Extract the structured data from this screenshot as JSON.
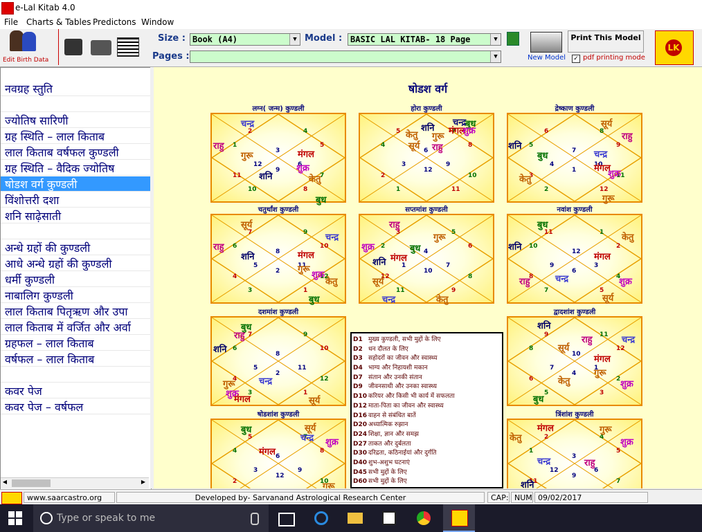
{
  "window": {
    "title": "e-Lal Kitab 4.0"
  },
  "menu": [
    "File",
    "Charts & Tables",
    "Predictons",
    "Window"
  ],
  "toolbar": {
    "edit_birth_data": "Edit Birth Data",
    "size_label": "Size :",
    "size_value": "Book (A4)",
    "model_label": "Model :",
    "model_value": "BASIC LAL KITAB- 18 Page",
    "pages_label": "Pages :",
    "pages_value": "",
    "print_model": "Print This Model",
    "new_model": "New Model",
    "pdf_mode": "pdf printing mode"
  },
  "sidebar": {
    "items": [
      {
        "label": "नवग्रह स्तुति",
        "selected": false
      },
      {
        "label": "",
        "selected": false
      },
      {
        "label": "ज्योतिष सारिणी",
        "selected": false
      },
      {
        "label": "ग्रह स्थिति – लाल किताब",
        "selected": false
      },
      {
        "label": "लाल किताब वर्षफल कुण्डली",
        "selected": false
      },
      {
        "label": "ग्रह स्थिति – वैदिक ज्योतिष",
        "selected": false
      },
      {
        "label": "षोडश वर्ग कुण्डली",
        "selected": true
      },
      {
        "label": "विंशोत्तरी दशा",
        "selected": false
      },
      {
        "label": "शनि साढ़ेसाती",
        "selected": false
      },
      {
        "label": "",
        "selected": false
      },
      {
        "label": "अन्धे ग्रहों की कुण्डली",
        "selected": false
      },
      {
        "label": "आधे अन्धे ग्रहों की कुण्डली",
        "selected": false
      },
      {
        "label": "धर्मी कुण्डली",
        "selected": false
      },
      {
        "label": "नाबालिग कुण्डली",
        "selected": false
      },
      {
        "label": "लाल किताब पितृऋण और उपा",
        "selected": false
      },
      {
        "label": "लाल किताब में वर्जित और अर्वा",
        "selected": false
      },
      {
        "label": "ग्रहफल – लाल किताब",
        "selected": false
      },
      {
        "label": "वर्षफल – लाल किताब",
        "selected": false
      },
      {
        "label": "",
        "selected": false
      },
      {
        "label": "कवर पेज",
        "selected": false
      },
      {
        "label": "कवर पेज – वर्षफल",
        "selected": false
      }
    ]
  },
  "main": {
    "heading": "षोडश वर्ग",
    "charts": [
      {
        "title": "लग्न( जन्म) कुण्डली",
        "houses": [
          "3",
          "2",
          "1",
          "12",
          "11",
          "10",
          "9",
          "8",
          "7",
          "6",
          "5",
          "4"
        ],
        "planets": [
          [
            "चन्द्र",
            "#3a3ad0",
            42,
            4
          ],
          [
            "राहु",
            "#c00080",
            2,
            36
          ],
          [
            "गुरू",
            "#c06000",
            42,
            50
          ],
          [
            "मंगल",
            "#c00000",
            124,
            48
          ],
          [
            "शुक्र",
            "#c000c0",
            122,
            68
          ],
          [
            "शनि",
            "#000066",
            68,
            80
          ],
          [
            "केतु",
            "#c06000",
            140,
            84
          ],
          [
            "बुध",
            "#007000",
            150,
            114
          ]
        ]
      },
      {
        "title": "होरा कुण्डली",
        "houses": [
          "6",
          "5",
          "4",
          "3",
          "2",
          "1",
          "12",
          "11",
          "10",
          "9",
          "8",
          "7"
        ],
        "planets": [
          [
            "शनि",
            "#000066",
            88,
            10
          ],
          [
            "चन्द्र",
            "#0a0a7a",
            134,
            2
          ],
          [
            "बुध",
            "#007000",
            152,
            4
          ],
          [
            "केतु",
            "#c06000",
            66,
            20
          ],
          [
            "गुरू",
            "#c06000",
            104,
            22
          ],
          [
            "सूर्य",
            "#c06000",
            70,
            36
          ],
          [
            "राहु",
            "#c00080",
            104,
            38
          ],
          [
            "मंगल",
            "#c00000",
            128,
            14
          ],
          [
            "शुक्र",
            "#c000c0",
            148,
            14
          ]
        ]
      },
      {
        "title": "द्रेष्काण कुण्डली",
        "houses": [
          "7",
          "6",
          "5",
          "4",
          "3",
          "2",
          "1",
          "12",
          "11",
          "10",
          "9",
          "8"
        ],
        "planets": [
          [
            "सूर्य",
            "#c06000",
            134,
            4
          ],
          [
            "राहु",
            "#c00080",
            164,
            22
          ],
          [
            "शनि",
            "#000066",
            0,
            36
          ],
          [
            "बुध",
            "#007000",
            42,
            50
          ],
          [
            "चन्द्र",
            "#3a3ad0",
            124,
            48
          ],
          [
            "मंगल",
            "#c00000",
            124,
            68
          ],
          [
            "शुक्र",
            "#c000c0",
            144,
            76
          ],
          [
            "केतु",
            "#c06000",
            16,
            84
          ],
          [
            "गुरू",
            "#c06000",
            136,
            112
          ]
        ]
      },
      {
        "title": "चतुर्थांश कुण्डली",
        "houses": [
          "8",
          "7",
          "6",
          "5",
          "4",
          "3",
          "2",
          "1",
          "12",
          "11",
          "10",
          "9"
        ],
        "planets": [
          [
            "सूर्य",
            "#c06000",
            42,
            4
          ],
          [
            "चन्द्र",
            "#3a3ad0",
            164,
            22
          ],
          [
            "राहु",
            "#c00080",
            2,
            36
          ],
          [
            "शनि",
            "#000066",
            42,
            50
          ],
          [
            "मंगल",
            "#c00000",
            124,
            48
          ],
          [
            "गुरू",
            "#c06000",
            124,
            68
          ],
          [
            "शुक्र",
            "#c000c0",
            144,
            76
          ],
          [
            "केतु",
            "#c06000",
            164,
            86
          ],
          [
            "बुध",
            "#007000",
            140,
            112
          ]
        ]
      },
      {
        "title": "सप्तमांश कुण्डली",
        "houses": [
          "4",
          "3",
          "2",
          "1",
          "12",
          "11",
          "10",
          "9",
          "8",
          "7",
          "6",
          "5"
        ],
        "planets": [
          [
            "राहु",
            "#c00080",
            42,
            4
          ],
          [
            "गुरू",
            "#c06000",
            106,
            22
          ],
          [
            "शुक्र",
            "#c000c0",
            2,
            36
          ],
          [
            "बुध",
            "#007000",
            72,
            38
          ],
          [
            "शनि",
            "#000066",
            18,
            58
          ],
          [
            "मंगल",
            "#c00000",
            44,
            52
          ],
          [
            "सूर्य",
            "#c06000",
            18,
            86
          ],
          [
            "केतु",
            "#c06000",
            110,
            112
          ],
          [
            "चन्द्र",
            "#3a3ad0",
            32,
            112
          ]
        ]
      },
      {
        "title": "नवांश कुण्डली",
        "houses": [
          "12",
          "11",
          "10",
          "9",
          "8",
          "7",
          "6",
          "5",
          "4",
          "3",
          "2",
          "1"
        ],
        "planets": [
          [
            "बुध",
            "#007000",
            42,
            4
          ],
          [
            "केतु",
            "#c06000",
            164,
            22
          ],
          [
            "शनि",
            "#000066",
            0,
            36
          ],
          [
            "मंगल",
            "#c00000",
            124,
            50
          ],
          [
            "राहु",
            "#c00080",
            16,
            86
          ],
          [
            "चन्द्र",
            "#3a3ad0",
            68,
            82
          ],
          [
            "शुक्र",
            "#c000c0",
            160,
            86
          ],
          [
            "सूर्य",
            "#c06000",
            136,
            110
          ]
        ]
      },
      {
        "title": "दशमांश कुण्डली",
        "houses": [
          "8",
          "7",
          "6",
          "5",
          "4",
          "3",
          "2",
          "1",
          "12",
          "11",
          "10",
          "9"
        ],
        "planets": [
          [
            "बुध",
            "#007000",
            42,
            4
          ],
          [
            "राहु",
            "#c00080",
            32,
            16
          ],
          [
            "शनि",
            "#000066",
            2,
            36
          ],
          [
            "चन्द्र",
            "#3a3ad0",
            68,
            82
          ],
          [
            "गुरू",
            "#c06000",
            16,
            86
          ],
          [
            "शुक्र",
            "#c000c0",
            20,
            100
          ],
          [
            "मंगल",
            "#c00000",
            32,
            108
          ],
          [
            "सूर्य",
            "#c06000",
            140,
            110
          ]
        ]
      },
      {
        "title": "द्वादशांश कुण्डली",
        "houses": [
          "10",
          "9",
          "8",
          "7",
          "6",
          "5",
          "4",
          "3",
          "2",
          "1",
          "12",
          "11"
        ],
        "planets": [
          [
            "शनि",
            "#000066",
            42,
            2
          ],
          [
            "राहु",
            "#c00080",
            106,
            22
          ],
          [
            "चन्द्र",
            "#3a3ad0",
            164,
            22
          ],
          [
            "सूर्य",
            "#c06000",
            72,
            34
          ],
          [
            "मंगल",
            "#c00000",
            124,
            50
          ],
          [
            "गुरू",
            "#c06000",
            124,
            70
          ],
          [
            "केतु",
            "#c06000",
            72,
            82
          ],
          [
            "शुक्र",
            "#c000c0",
            162,
            86
          ],
          [
            "बुध",
            "#007000",
            36,
            108
          ]
        ]
      },
      {
        "title": "षोडशांश कुण्डली",
        "houses": [
          "6",
          "5",
          "4",
          "3",
          "2",
          "1",
          "12",
          "11",
          "10",
          "9",
          "8",
          "7"
        ],
        "planets": [
          [
            "बुध",
            "#007000",
            42,
            4
          ],
          [
            "सूर्य",
            "#c06000",
            134,
            2
          ],
          [
            "चन्द्र",
            "#3a3ad0",
            128,
            16
          ],
          [
            "शुक्र",
            "#c000c0",
            164,
            22
          ],
          [
            "मंगल",
            "#c00000",
            68,
            36
          ],
          [
            "गुरू",
            "#c06000",
            160,
            86
          ]
        ]
      },
      {
        "title": "त्रिंशांश कुण्डली",
        "houses": [
          "3",
          "2",
          "1",
          "12",
          "11",
          "10",
          "9",
          "8",
          "7",
          "6",
          "5",
          "4"
        ],
        "planets": [
          [
            "मंगल",
            "#c00000",
            42,
            2
          ],
          [
            "गुरू",
            "#c06000",
            132,
            4
          ],
          [
            "केतु",
            "#c06000",
            2,
            16
          ],
          [
            "शुक्र",
            "#c000c0",
            162,
            22
          ],
          [
            "चन्द्र",
            "#3a3ad0",
            42,
            50
          ],
          [
            "राहु",
            "#c00080",
            110,
            52
          ],
          [
            "शनि",
            "#000066",
            18,
            84
          ]
        ]
      }
    ],
    "legend": [
      {
        "code": "D1",
        "text": "मुख्य कुण्डली, सभी मुद्दों के लिए"
      },
      {
        "code": "D2",
        "text": "धन दौलत के लिए"
      },
      {
        "code": "D3",
        "text": "सहोदरों का जीवन और स्वास्थ्य"
      },
      {
        "code": "D4",
        "text": "भाग्य और निहायशी मकान"
      },
      {
        "code": "D7",
        "text": "संतान और उनकी संतान"
      },
      {
        "code": "D9",
        "text": "जीवनसाथी और उनका स्वास्थ्य"
      },
      {
        "code": "D10",
        "text": "करियर और किसी भी कार्य में सफलता"
      },
      {
        "code": "D12",
        "text": "माता-पिता का जीवन और स्वास्थ्य"
      },
      {
        "code": "D16",
        "text": "वाहन से संबंधित बातें"
      },
      {
        "code": "D20",
        "text": "अध्यात्मिक रुझान"
      },
      {
        "code": "D24",
        "text": "शिक्षा, ज्ञान और समझ"
      },
      {
        "code": "D27",
        "text": "ताकत और दुर्बलता"
      },
      {
        "code": "D30",
        "text": "दरिद्रता, कठिनाईयां और दुर्गति"
      },
      {
        "code": "D40",
        "text": "शुभ-अशुभ घटनाएं"
      },
      {
        "code": "D45",
        "text": "सभी मुद्दों के लिए"
      },
      {
        "code": "D60",
        "text": "सभी मुद्दों के लिए"
      }
    ]
  },
  "status": {
    "website": "www.saarcastro.org",
    "developer": "Developed by- Sarvanand Astrological Research Center",
    "caps": "CAP:",
    "num": "NUM",
    "date": "09/02/2017"
  },
  "taskbar": {
    "search_placeholder": "Type or speak to me"
  }
}
